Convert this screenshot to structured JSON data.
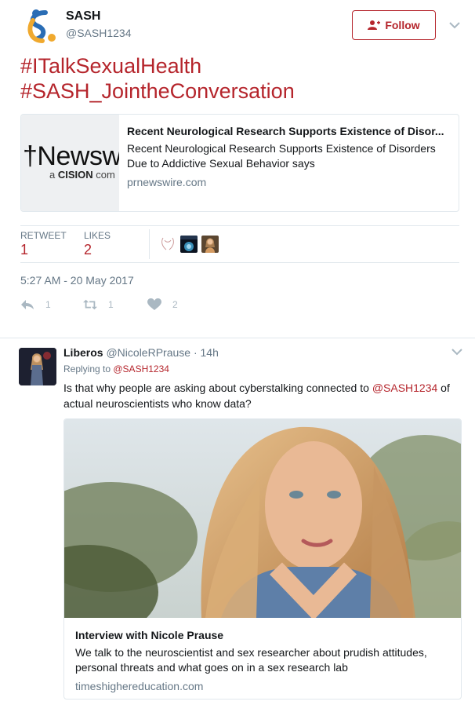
{
  "tweet": {
    "author": {
      "name": "SASH",
      "handle": "@SASH1234"
    },
    "follow_label": "Follow",
    "text_lines": [
      "#ITalkSexualHealth",
      "#SASH_JointheConversation"
    ],
    "card": {
      "thumb_brand": "Newsw",
      "thumb_sub_prefix": "a ",
      "thumb_sub_brand": "CISION",
      "thumb_sub_suffix": " com",
      "title": "Recent Neurological Research Supports Existence of Disor...",
      "description": "Recent Neurological Research Supports Existence of Disorders Due to Addictive Sexual Behavior says",
      "domain": "prnewswire.com"
    },
    "stats": {
      "retweets_label": "RETWEET",
      "retweets_value": "1",
      "likes_label": "LIKES",
      "likes_value": "2"
    },
    "timestamp": "5:27 AM - 20 May 2017",
    "actions": {
      "reply_count": "1",
      "retweet_count": "1",
      "like_count": "2"
    }
  },
  "reply": {
    "name": "Liberos",
    "handle": "@NicoleRPrause",
    "dot": "·",
    "time": "14h",
    "replying_prefix": "Replying to ",
    "replying_to": "@SASH1234",
    "text_before": "Is that why people are asking about cyberstalking connected to ",
    "text_mention": "@SASH1234",
    "text_after": " of actual neuroscientists who know data?",
    "card": {
      "title": "Interview with Nicole Prause",
      "description": "We talk to the neuroscientist and sex researcher about prudish attitudes, personal threats and what goes on in a sex research lab",
      "domain": "timeshighereducation.com"
    }
  },
  "colors": {
    "accent": "#b5252c",
    "muted": "#657786",
    "border": "#e1e8ed",
    "icon": "#aab8c2"
  },
  "icons": [
    "sash-logo-icon",
    "add-user-icon",
    "chevron-down-icon",
    "reply-icon",
    "retweet-icon",
    "heart-icon"
  ]
}
